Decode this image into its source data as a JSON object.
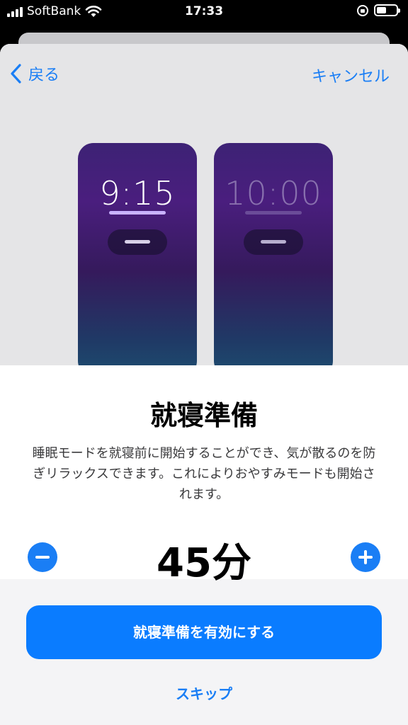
{
  "status_bar": {
    "carrier": "SoftBank",
    "time": "17:33",
    "battery_level": 0.5
  },
  "nav": {
    "back_label": "戻る",
    "cancel_label": "キャンセル"
  },
  "preview": {
    "before_time": "9:15",
    "after_time": "10:00"
  },
  "content": {
    "title": "就寝準備",
    "description": "睡眠モードを就寝前に開始することができ、気が散るのを防ぎリラックスできます。これによりおやすみモードも開始されます。"
  },
  "stepper": {
    "value": "45分"
  },
  "actions": {
    "primary_label": "就寝準備を有効にする",
    "skip_label": "スキップ"
  },
  "colors": {
    "accent": "#0a7cff"
  }
}
